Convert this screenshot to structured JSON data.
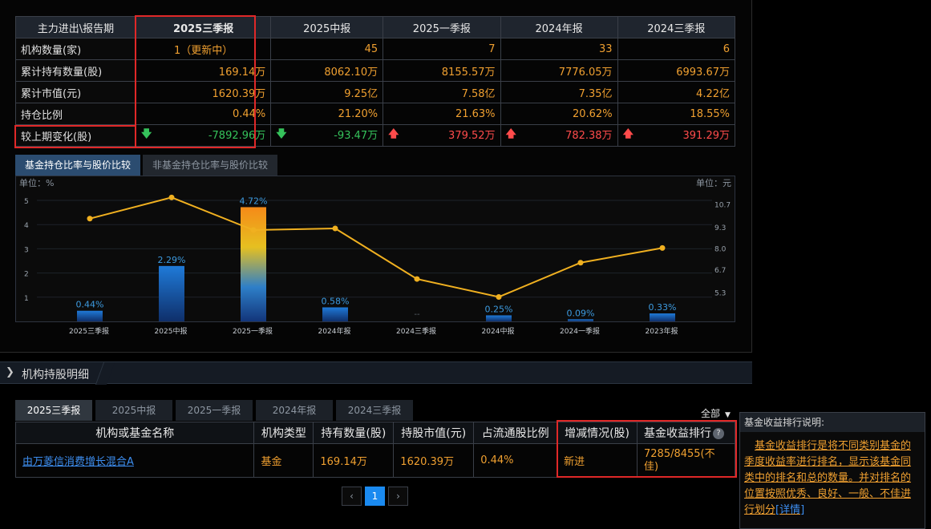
{
  "summary": {
    "header_label": "主力进出\\报告期",
    "periods": [
      "2025三季报",
      "2025中报",
      "2025一季报",
      "2024年报",
      "2024三季报"
    ],
    "rows": [
      {
        "label": "机构数量(家)",
        "values": [
          "1（更新中）",
          "45",
          "7",
          "33",
          "6"
        ]
      },
      {
        "label": "累计持有数量(股)",
        "values": [
          "169.14万",
          "8062.10万",
          "8155.57万",
          "7776.05万",
          "6993.67万"
        ]
      },
      {
        "label": "累计市值(元)",
        "values": [
          "1620.39万",
          "9.25亿",
          "7.58亿",
          "7.35亿",
          "4.22亿"
        ]
      },
      {
        "label": "持仓比例",
        "values": [
          "0.44%",
          "21.20%",
          "21.63%",
          "20.62%",
          "18.55%"
        ]
      }
    ],
    "change_row": {
      "label": "较上期变化(股)",
      "values": [
        "-7892.96万",
        "-93.47万",
        "379.52万",
        "782.38万",
        "391.29万"
      ],
      "directions": [
        "down",
        "down",
        "up",
        "up",
        "up"
      ],
      "up_arrow": "🡅",
      "down_arrow": "🡇"
    }
  },
  "chart_tabs": {
    "active": "基金持仓比率与股价比较",
    "inactive": "非基金持仓比率与股价比较"
  },
  "chart_data": {
    "type": "bar",
    "categories": [
      "2025三季报",
      "2025中报",
      "2025一季报",
      "2024年报",
      "2024三季报",
      "2024中报",
      "2024一季报",
      "2023年报"
    ],
    "series": [
      {
        "values": [
          0.44,
          2.29,
          4.72,
          0.58,
          null,
          0.25,
          0.09,
          0.33
        ]
      },
      {
        "type": "line",
        "axis": "right",
        "values": [
          9.8,
          11.1,
          9.1,
          9.2,
          6.1,
          5.0,
          7.1,
          8.0
        ]
      }
    ],
    "bar_labels": [
      "0.44%",
      "2.29%",
      "4.72%",
      "0.58%",
      "--",
      "0.25%",
      "0.09%",
      "0.33%"
    ],
    "ylabel": "单位：%",
    "ylabel_right": "单位：元",
    "yticks": [
      "1",
      "2",
      "3",
      "4",
      "5"
    ],
    "yticks_right": [
      "5.3",
      "6.7",
      "8.0",
      "9.3",
      "10.7"
    ],
    "ylim": [
      0,
      5.5
    ],
    "ylim_right": [
      3.5,
      12.0
    ],
    "grid": true,
    "colors": {
      "bar": "#1a5fb4",
      "bar_highlight": "#f0a030",
      "line": "#f0b020"
    }
  },
  "section": {
    "title": "机构持股明细",
    "chevron": "❯"
  },
  "period_tabs": [
    "2025三季报",
    "2025中报",
    "2025一季报",
    "2024年报",
    "2024三季报"
  ],
  "filter": {
    "label": "全部",
    "caret": "▼"
  },
  "detail": {
    "columns": [
      "机构或基金名称",
      "机构类型",
      "持有数量(股)",
      "持股市值(元)",
      "占流通股比例",
      "增减情况(股)",
      "基金收益排行"
    ],
    "rows": [
      {
        "name": "由万菱信消费增长混合A",
        "type": "基金",
        "qty": "169.14万",
        "value": "1620.39万",
        "ratio": "0.44%",
        "change": "新进",
        "rank": "7285/8455(不佳)"
      }
    ],
    "help_icon": "?"
  },
  "pager": {
    "prev": "‹",
    "current": "1",
    "next": "›"
  },
  "tooltip": {
    "title": "基金收益排行说明:",
    "body": "基金收益排行是将不同类别基金的季度收益率进行排名，显示该基金同类中的排名和总的数量。并对排名的位置按照优秀、良好、一般、不佳进行划分",
    "link": "[详情]"
  },
  "colors": {
    "highlight_box": "#e02828",
    "accent_orange": "#f0a030",
    "up": "#ff4b4b",
    "down": "#35c25b",
    "link": "#3d8ef0"
  }
}
